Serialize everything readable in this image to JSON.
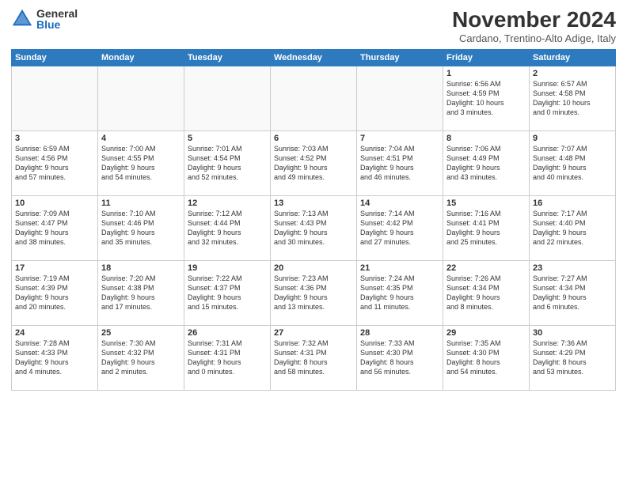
{
  "logo": {
    "general": "General",
    "blue": "Blue"
  },
  "title": {
    "month_year": "November 2024",
    "location": "Cardano, Trentino-Alto Adige, Italy"
  },
  "weekdays": [
    "Sunday",
    "Monday",
    "Tuesday",
    "Wednesday",
    "Thursday",
    "Friday",
    "Saturday"
  ],
  "weeks": [
    [
      {
        "day": "",
        "text": ""
      },
      {
        "day": "",
        "text": ""
      },
      {
        "day": "",
        "text": ""
      },
      {
        "day": "",
        "text": ""
      },
      {
        "day": "",
        "text": ""
      },
      {
        "day": "1",
        "text": "Sunrise: 6:56 AM\nSunset: 4:59 PM\nDaylight: 10 hours\nand 3 minutes."
      },
      {
        "day": "2",
        "text": "Sunrise: 6:57 AM\nSunset: 4:58 PM\nDaylight: 10 hours\nand 0 minutes."
      }
    ],
    [
      {
        "day": "3",
        "text": "Sunrise: 6:59 AM\nSunset: 4:56 PM\nDaylight: 9 hours\nand 57 minutes."
      },
      {
        "day": "4",
        "text": "Sunrise: 7:00 AM\nSunset: 4:55 PM\nDaylight: 9 hours\nand 54 minutes."
      },
      {
        "day": "5",
        "text": "Sunrise: 7:01 AM\nSunset: 4:54 PM\nDaylight: 9 hours\nand 52 minutes."
      },
      {
        "day": "6",
        "text": "Sunrise: 7:03 AM\nSunset: 4:52 PM\nDaylight: 9 hours\nand 49 minutes."
      },
      {
        "day": "7",
        "text": "Sunrise: 7:04 AM\nSunset: 4:51 PM\nDaylight: 9 hours\nand 46 minutes."
      },
      {
        "day": "8",
        "text": "Sunrise: 7:06 AM\nSunset: 4:49 PM\nDaylight: 9 hours\nand 43 minutes."
      },
      {
        "day": "9",
        "text": "Sunrise: 7:07 AM\nSunset: 4:48 PM\nDaylight: 9 hours\nand 40 minutes."
      }
    ],
    [
      {
        "day": "10",
        "text": "Sunrise: 7:09 AM\nSunset: 4:47 PM\nDaylight: 9 hours\nand 38 minutes."
      },
      {
        "day": "11",
        "text": "Sunrise: 7:10 AM\nSunset: 4:46 PM\nDaylight: 9 hours\nand 35 minutes."
      },
      {
        "day": "12",
        "text": "Sunrise: 7:12 AM\nSunset: 4:44 PM\nDaylight: 9 hours\nand 32 minutes."
      },
      {
        "day": "13",
        "text": "Sunrise: 7:13 AM\nSunset: 4:43 PM\nDaylight: 9 hours\nand 30 minutes."
      },
      {
        "day": "14",
        "text": "Sunrise: 7:14 AM\nSunset: 4:42 PM\nDaylight: 9 hours\nand 27 minutes."
      },
      {
        "day": "15",
        "text": "Sunrise: 7:16 AM\nSunset: 4:41 PM\nDaylight: 9 hours\nand 25 minutes."
      },
      {
        "day": "16",
        "text": "Sunrise: 7:17 AM\nSunset: 4:40 PM\nDaylight: 9 hours\nand 22 minutes."
      }
    ],
    [
      {
        "day": "17",
        "text": "Sunrise: 7:19 AM\nSunset: 4:39 PM\nDaylight: 9 hours\nand 20 minutes."
      },
      {
        "day": "18",
        "text": "Sunrise: 7:20 AM\nSunset: 4:38 PM\nDaylight: 9 hours\nand 17 minutes."
      },
      {
        "day": "19",
        "text": "Sunrise: 7:22 AM\nSunset: 4:37 PM\nDaylight: 9 hours\nand 15 minutes."
      },
      {
        "day": "20",
        "text": "Sunrise: 7:23 AM\nSunset: 4:36 PM\nDaylight: 9 hours\nand 13 minutes."
      },
      {
        "day": "21",
        "text": "Sunrise: 7:24 AM\nSunset: 4:35 PM\nDaylight: 9 hours\nand 11 minutes."
      },
      {
        "day": "22",
        "text": "Sunrise: 7:26 AM\nSunset: 4:34 PM\nDaylight: 9 hours\nand 8 minutes."
      },
      {
        "day": "23",
        "text": "Sunrise: 7:27 AM\nSunset: 4:34 PM\nDaylight: 9 hours\nand 6 minutes."
      }
    ],
    [
      {
        "day": "24",
        "text": "Sunrise: 7:28 AM\nSunset: 4:33 PM\nDaylight: 9 hours\nand 4 minutes."
      },
      {
        "day": "25",
        "text": "Sunrise: 7:30 AM\nSunset: 4:32 PM\nDaylight: 9 hours\nand 2 minutes."
      },
      {
        "day": "26",
        "text": "Sunrise: 7:31 AM\nSunset: 4:31 PM\nDaylight: 9 hours\nand 0 minutes."
      },
      {
        "day": "27",
        "text": "Sunrise: 7:32 AM\nSunset: 4:31 PM\nDaylight: 8 hours\nand 58 minutes."
      },
      {
        "day": "28",
        "text": "Sunrise: 7:33 AM\nSunset: 4:30 PM\nDaylight: 8 hours\nand 56 minutes."
      },
      {
        "day": "29",
        "text": "Sunrise: 7:35 AM\nSunset: 4:30 PM\nDaylight: 8 hours\nand 54 minutes."
      },
      {
        "day": "30",
        "text": "Sunrise: 7:36 AM\nSunset: 4:29 PM\nDaylight: 8 hours\nand 53 minutes."
      }
    ]
  ]
}
